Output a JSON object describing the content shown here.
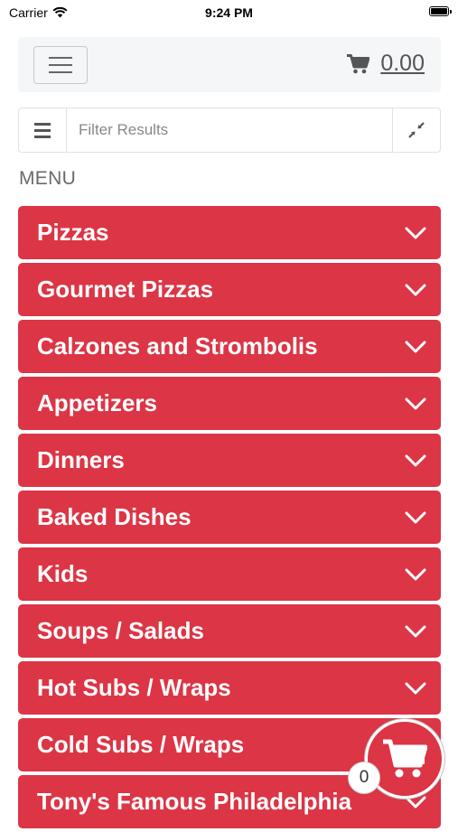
{
  "status_bar": {
    "carrier": "Carrier",
    "time": "9:24 PM",
    "battery_level": 1.0
  },
  "navbar": {
    "cart_icon": "cart-icon",
    "cart_total": "0.00",
    "menu_icon": "hamburger-icon"
  },
  "filter": {
    "placeholder": "Filter Results",
    "value": "",
    "list_icon": "list-icon",
    "collapse_icon": "compress-arrows-icon"
  },
  "menu_heading": "MENU",
  "categories": [
    {
      "label": "Pizzas"
    },
    {
      "label": "Gourmet Pizzas"
    },
    {
      "label": "Calzones and Strombolis"
    },
    {
      "label": "Appetizers"
    },
    {
      "label": "Dinners"
    },
    {
      "label": "Baked Dishes"
    },
    {
      "label": "Kids"
    },
    {
      "label": "Soups / Salads"
    },
    {
      "label": "Hot Subs / Wraps"
    },
    {
      "label": "Cold Subs / Wraps"
    },
    {
      "label": "Tony's Famous Philadelphia"
    }
  ],
  "floating_cart": {
    "icon": "cart-icon",
    "count": "0"
  },
  "colors": {
    "accent": "#dc3545",
    "navbar_bg": "#f4f6f8"
  }
}
